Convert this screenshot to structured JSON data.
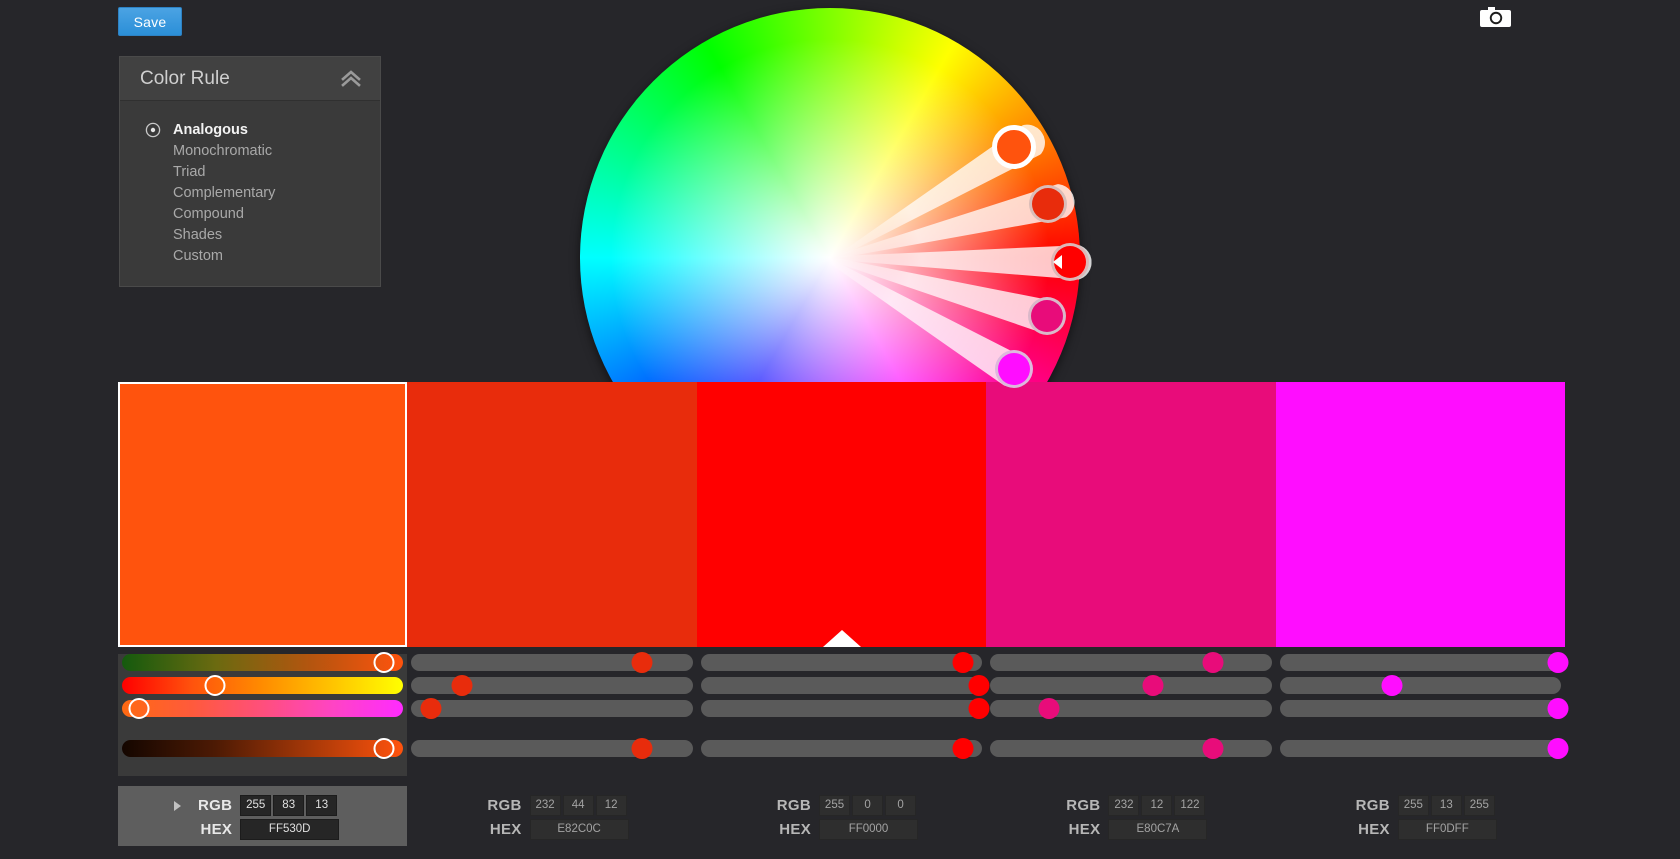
{
  "app": {
    "background": "#26262a"
  },
  "toolbar": {
    "save_label": "Save",
    "save_color": "#2b8fd8",
    "camera_icon": "camera-icon"
  },
  "color_rule_panel": {
    "title": "Color Rule",
    "collapse_icon": "chevron-double-up-icon",
    "selected": "Analogous",
    "items": [
      {
        "label": "Analogous",
        "selected": true
      },
      {
        "label": "Monochromatic",
        "selected": false
      },
      {
        "label": "Triad",
        "selected": false
      },
      {
        "label": "Complementary",
        "selected": false
      },
      {
        "label": "Compound",
        "selected": false
      },
      {
        "label": "Shades",
        "selected": false
      },
      {
        "label": "Custom",
        "selected": false
      }
    ]
  },
  "swatches": [
    {
      "index": 0,
      "active": true,
      "hex_display": "FF530D",
      "color": "#FF530D",
      "rgb_label": "RGB",
      "hex_label": "HEX",
      "rgb": {
        "r": "255",
        "g": "83",
        "b": "13"
      },
      "expander_icon": "caret-right-icon",
      "sliders": [
        {
          "name": "saturation",
          "value_pct": 93,
          "knob": "ring",
          "gradient": "linear-gradient(to right,#145a0e,#6b6a10,#b3550f,#ff530d)"
        },
        {
          "name": "hue",
          "value_pct": 33,
          "knob": "ring",
          "gradient": "linear-gradient(to right,#ff0000,#ff530d,#ff8c00,#ffc400,#ffff00)"
        },
        {
          "name": "tint",
          "value_pct": 6,
          "knob": "ring",
          "gradient": "linear-gradient(to right,#ff6a12,#ff5a3c,#ff4f7c,#ff44c4,#ff2bff)"
        },
        {
          "name": "brightness",
          "value_pct": 93,
          "knob": "ring",
          "gradient": "linear-gradient(to right,#140600,#4d1a04,#a63808,#ff530d)"
        }
      ]
    },
    {
      "index": 1,
      "active": false,
      "hex_display": "E82C0C",
      "color": "#E82C0C",
      "rgb_label": "RGB",
      "hex_label": "HEX",
      "rgb": {
        "r": "232",
        "g": "44",
        "b": "12"
      },
      "sliders": [
        {
          "name": "saturation",
          "value_pct": 82,
          "knob": "dot"
        },
        {
          "name": "hue",
          "value_pct": 18,
          "knob": "dot"
        },
        {
          "name": "tint",
          "value_pct": 7,
          "knob": "dot"
        },
        {
          "name": "brightness",
          "value_pct": 82,
          "knob": "dot"
        }
      ]
    },
    {
      "index": 2,
      "active": false,
      "hex_display": "FF0000",
      "color": "#FF0000",
      "rgb_label": "RGB",
      "hex_label": "HEX",
      "rgb": {
        "r": "255",
        "g": "0",
        "b": "0"
      },
      "sliders": [
        {
          "name": "saturation",
          "value_pct": 93,
          "knob": "dot"
        },
        {
          "name": "hue",
          "value_pct": 99,
          "knob": "dot"
        },
        {
          "name": "tint",
          "value_pct": 99,
          "knob": "dot"
        },
        {
          "name": "brightness",
          "value_pct": 93,
          "knob": "dot"
        }
      ]
    },
    {
      "index": 3,
      "active": false,
      "hex_display": "E80C7A",
      "color": "#E80C7A",
      "rgb_label": "RGB",
      "hex_label": "HEX",
      "rgb": {
        "r": "232",
        "g": "12",
        "b": "122"
      },
      "sliders": [
        {
          "name": "saturation",
          "value_pct": 79,
          "knob": "dot"
        },
        {
          "name": "hue",
          "value_pct": 58,
          "knob": "dot"
        },
        {
          "name": "tint",
          "value_pct": 21,
          "knob": "dot"
        },
        {
          "name": "brightness",
          "value_pct": 79,
          "knob": "dot"
        }
      ]
    },
    {
      "index": 4,
      "active": false,
      "hex_display": "FF0DFF",
      "color": "#FF0DFF",
      "rgb_label": "RGB",
      "hex_label": "HEX",
      "rgb": {
        "r": "255",
        "g": "13",
        "b": "255"
      },
      "sliders": [
        {
          "name": "saturation",
          "value_pct": 99,
          "knob": "dot"
        },
        {
          "name": "hue",
          "value_pct": 40,
          "knob": "dot"
        },
        {
          "name": "tint",
          "value_pct": 99,
          "knob": "dot"
        },
        {
          "name": "brightness",
          "value_pct": 99,
          "knob": "dot"
        }
      ]
    }
  ],
  "color_wheel": {
    "markers": [
      {
        "name": "marker-ff530d",
        "color": "#FF530D",
        "angle_deg": -31,
        "radius_pct": 0.86,
        "role": "base"
      },
      {
        "name": "marker-e82c0c",
        "color": "#E82C0C",
        "angle_deg": -14,
        "radius_pct": 0.9,
        "role": "sibling"
      },
      {
        "name": "marker-ff0000",
        "color": "#FF0000",
        "angle_deg": 1,
        "radius_pct": 0.96,
        "role": "pointer"
      },
      {
        "name": "marker-e80c7a",
        "color": "#E80C7A",
        "angle_deg": 15,
        "radius_pct": 0.9,
        "role": "sibling"
      },
      {
        "name": "marker-ff0dff",
        "color": "#FF0DFF",
        "angle_deg": 31,
        "radius_pct": 0.86,
        "role": "sibling"
      }
    ]
  }
}
